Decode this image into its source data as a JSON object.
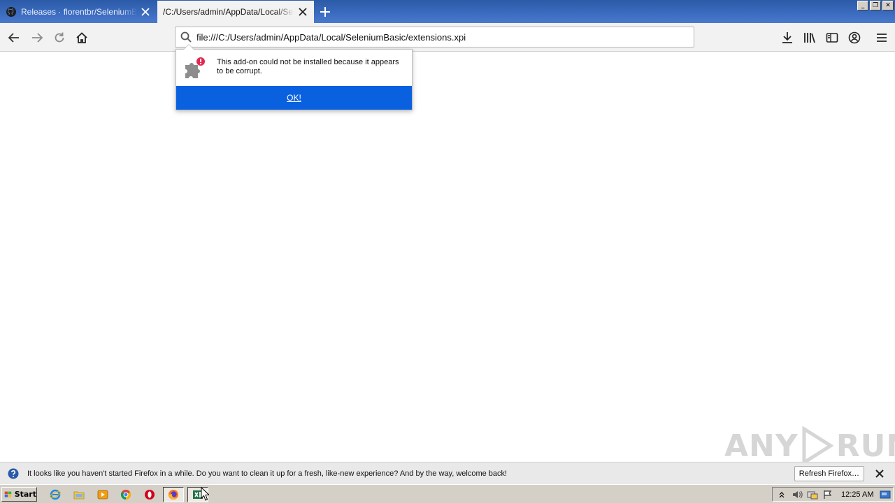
{
  "tabs": [
    {
      "label": "Releases · florentbr/SeleniumBasic",
      "active": false
    },
    {
      "label": "/C:/Users/admin/AppData/Local/SeleniumBasic/extensions.xpi",
      "active": true
    }
  ],
  "window_controls": {
    "minimize": "_",
    "maximize": "❐",
    "close": "✕"
  },
  "urlbar": {
    "value": "file:///C:/Users/admin/AppData/Local/SeleniumBasic/extensions.xpi"
  },
  "addon_popup": {
    "message": "This add-on could not be installed because it appears to be corrupt.",
    "ok_label": "OK!"
  },
  "watermark": {
    "left": "ANY",
    "right": "RUN"
  },
  "notification": {
    "message": "It looks like you haven't started Firefox in a while. Do you want to clean it up for a fresh, like-new experience? And by the way, welcome back!",
    "button_label": "Refresh Firefox…"
  },
  "taskbar": {
    "start_label": "Start",
    "clock": "12:25 AM"
  },
  "colors": {
    "tabstrip": "#3c6cc0",
    "popup_button": "#0a61e0",
    "toolbar": "#f2f2f2",
    "taskbar": "#d4d0c8"
  }
}
